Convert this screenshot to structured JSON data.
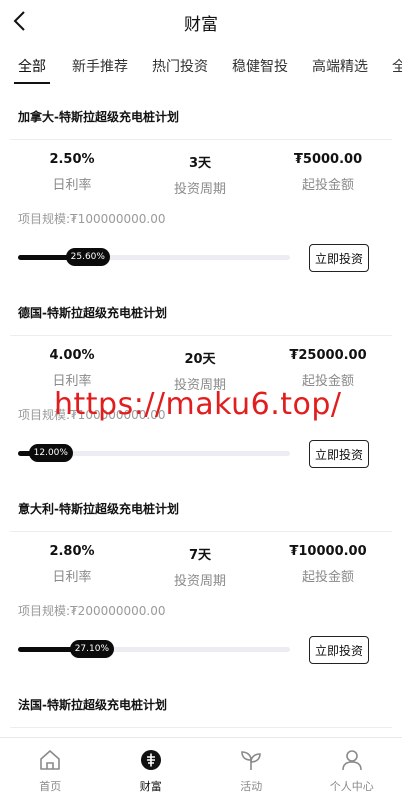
{
  "header": {
    "title": "财富",
    "back_icon": "chevron-left-icon"
  },
  "tabs": [
    {
      "label": "全部",
      "active": true
    },
    {
      "label": "新手推荐",
      "active": false
    },
    {
      "label": "热门投资",
      "active": false
    },
    {
      "label": "稳健智投",
      "active": false
    },
    {
      "label": "高端精选",
      "active": false
    },
    {
      "label": "全",
      "active": false
    }
  ],
  "products": [
    {
      "title": "加拿大-特斯拉超级充电桩计划",
      "rate": "2.50%",
      "rate_label": "日利率",
      "period": "3天",
      "period_label": "投资周期",
      "min": "₮5000.00",
      "min_label": "起投金额",
      "scale": "项目规模:₮100000000.00",
      "progress_text": "25.60%",
      "progress": 0.256,
      "button": "立即投资"
    },
    {
      "title": "德国-特斯拉超级充电桩计划",
      "rate": "4.00%",
      "rate_label": "日利率",
      "period": "20天",
      "period_label": "投资周期",
      "min": "₮25000.00",
      "min_label": "起投金额",
      "scale": "项目规模:₮100000000.00",
      "progress_text": "12.00%",
      "progress": 0.12,
      "button": "立即投资"
    },
    {
      "title": "意大利-特斯拉超级充电桩计划",
      "rate": "2.80%",
      "rate_label": "日利率",
      "period": "7天",
      "period_label": "投资周期",
      "min": "₮10000.00",
      "min_label": "起投金额",
      "scale": "项目规模:₮200000000.00",
      "progress_text": "27.10%",
      "progress": 0.271,
      "button": "立即投资"
    },
    {
      "title": "法国-特斯拉超级充电桩计划"
    }
  ],
  "watermark": "https://maku6.top/",
  "tabbar": [
    {
      "label": "首页",
      "icon": "home-icon",
      "active": false
    },
    {
      "label": "财富",
      "icon": "wealth-coin-icon",
      "active": true
    },
    {
      "label": "活动",
      "icon": "sprout-icon",
      "active": false
    },
    {
      "label": "个人中心",
      "icon": "user-icon",
      "active": false
    }
  ],
  "colors": {
    "accent": "#0b0b0b",
    "muted": "#8a8a8a",
    "track": "#ececf2",
    "watermark": "#e11d1d"
  }
}
